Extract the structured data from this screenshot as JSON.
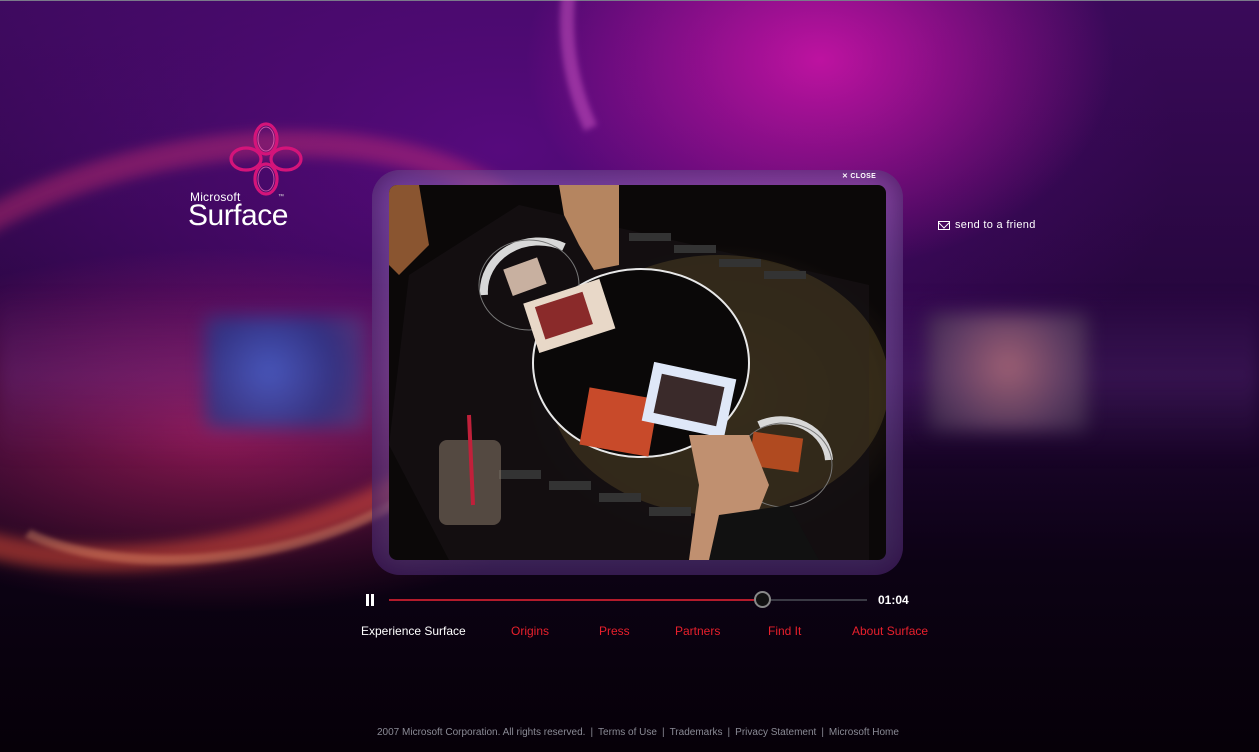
{
  "brand": {
    "microsoft": "Microsoft",
    "product": "Surface",
    "tm": "™",
    "accent_color": "#d4147a",
    "logo_icon": "surface-knot-logo"
  },
  "player": {
    "close_label": "CLOSE",
    "close_icon": "close-icon",
    "progress": 0.78,
    "time": "01:04",
    "play_state_icon": "pause-icon"
  },
  "share": {
    "send_label": "send to a friend",
    "icon": "mail-icon"
  },
  "nav": {
    "items": [
      {
        "label": "Experience Surface",
        "active": true
      },
      {
        "label": "Origins",
        "active": false
      },
      {
        "label": "Press",
        "active": false
      },
      {
        "label": "Partners",
        "active": false
      },
      {
        "label": "Find It",
        "active": false
      },
      {
        "label": "About Surface",
        "active": false
      }
    ],
    "link_color": "#e8202c"
  },
  "footer": {
    "copyright": "2007 Microsoft Corporation. All rights reserved.",
    "links": [
      "Terms of Use",
      "Trademarks",
      "Privacy Statement",
      "Microsoft Home"
    ]
  }
}
